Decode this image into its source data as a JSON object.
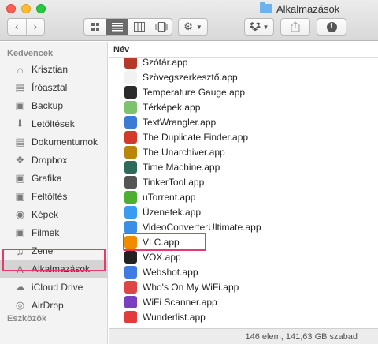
{
  "window": {
    "title": "Alkalmazások"
  },
  "toolbar": {
    "back_icon": "chevron-left-icon",
    "forward_icon": "chevron-right-icon",
    "views": [
      "icon-view-icon",
      "list-view-icon",
      "column-view-icon",
      "coverflow-view-icon"
    ],
    "active_view": 1,
    "gear_icon": "gear-icon",
    "dropbox_icon": "dropbox-icon",
    "share_icon": "share-icon",
    "info_icon": "info-icon"
  },
  "sidebar": {
    "favorites_header": "Kedvencek",
    "devices_header": "Eszközök",
    "items": [
      {
        "label": "Krisztian",
        "icon": "home-icon"
      },
      {
        "label": "Íróasztal",
        "icon": "desktop-icon"
      },
      {
        "label": "Backup",
        "icon": "folder-icon"
      },
      {
        "label": "Letöltések",
        "icon": "download-icon"
      },
      {
        "label": "Dokumentumok",
        "icon": "document-icon"
      },
      {
        "label": "Dropbox",
        "icon": "dropbox-icon"
      },
      {
        "label": "Grafika",
        "icon": "folder-icon"
      },
      {
        "label": "Feltöltés",
        "icon": "folder-icon"
      },
      {
        "label": "Képek",
        "icon": "camera-icon"
      },
      {
        "label": "Filmek",
        "icon": "film-icon"
      },
      {
        "label": "Zene",
        "icon": "music-icon"
      },
      {
        "label": "Alkalmazások",
        "icon": "applications-icon"
      },
      {
        "label": "iCloud Drive",
        "icon": "cloud-icon"
      },
      {
        "label": "AirDrop",
        "icon": "airdrop-icon"
      }
    ],
    "selected_index": 11
  },
  "list": {
    "column_header": "Név",
    "rows": [
      {
        "name": "Szótár.app",
        "icon": "dictionary-icon",
        "color": "#b33a2a"
      },
      {
        "name": "Szövegszerkesztő.app",
        "icon": "textedit-icon",
        "color": "#f2f2f2"
      },
      {
        "name": "Temperature Gauge.app",
        "icon": "gauge-icon",
        "color": "#2b2b2b"
      },
      {
        "name": "Térképek.app",
        "icon": "maps-icon",
        "color": "#7cc36b"
      },
      {
        "name": "TextWrangler.app",
        "icon": "textwrangler-icon",
        "color": "#3a7bd5"
      },
      {
        "name": "The Duplicate Finder.app",
        "icon": "duplicate-finder-icon",
        "color": "#d33a2c"
      },
      {
        "name": "The Unarchiver.app",
        "icon": "unarchiver-icon",
        "color": "#b8860b"
      },
      {
        "name": "Time Machine.app",
        "icon": "time-machine-icon",
        "color": "#2e6b5a"
      },
      {
        "name": "TinkerTool.app",
        "icon": "tinkertool-icon",
        "color": "#555555"
      },
      {
        "name": "uTorrent.app",
        "icon": "utorrent-icon",
        "color": "#4caf32"
      },
      {
        "name": "Üzenetek.app",
        "icon": "messages-icon",
        "color": "#3b9bf0"
      },
      {
        "name": "VideoConverterUltimate.app",
        "icon": "video-converter-icon",
        "color": "#3a8ee6"
      },
      {
        "name": "VLC.app",
        "icon": "vlc-icon",
        "color": "#f18b00"
      },
      {
        "name": "VOX.app",
        "icon": "vox-icon",
        "color": "#222222"
      },
      {
        "name": "Webshot.app",
        "icon": "webshot-icon",
        "color": "#3f7be0"
      },
      {
        "name": "Who's On My WiFi.app",
        "icon": "wifi-icon",
        "color": "#e04545"
      },
      {
        "name": "WiFi Scanner.app",
        "icon": "wifi-scanner-icon",
        "color": "#7a3fc0"
      },
      {
        "name": "Wunderlist.app",
        "icon": "wunderlist-icon",
        "color": "#e23b3b"
      }
    ]
  },
  "status": {
    "text": "146 elem, 141,63 GB szabad"
  },
  "accent": {
    "highlight": "#e8396c",
    "selected_bg": "#d4d4d4"
  }
}
